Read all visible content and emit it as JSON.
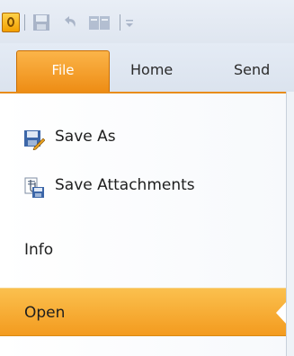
{
  "quick_access": {
    "icons": [
      "outlook-logo-icon",
      "save-icon",
      "undo-icon",
      "address-book-icon",
      "customize-toolbar-icon"
    ]
  },
  "ribbon": {
    "tabs": [
      {
        "label": "File",
        "active": true
      },
      {
        "label": "Home",
        "active": false
      },
      {
        "label": "Send",
        "active": false
      }
    ]
  },
  "backstage": {
    "items": [
      {
        "label": "Save As",
        "icon": "save-as-icon"
      },
      {
        "label": "Save Attachments",
        "icon": "save-attachments-icon"
      },
      {
        "label": "Info"
      },
      {
        "label": "Open",
        "selected": true
      }
    ]
  },
  "colors": {
    "accent_orange": "#f39b1f",
    "file_tab": "#ee8d15",
    "ribbon_bg": "#dfe6f0"
  }
}
